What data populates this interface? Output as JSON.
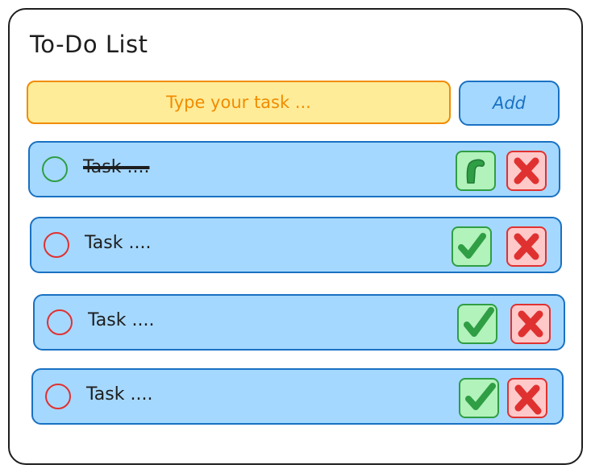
{
  "app": {
    "title": "To-Do List"
  },
  "input": {
    "placeholder": "Type your task ...",
    "value": ""
  },
  "add_button": {
    "label": "Add"
  },
  "tasks": [
    {
      "text": "Task ....",
      "done": true,
      "complete_icon": "check-icon",
      "delete_icon": "x-icon"
    },
    {
      "text": "Task ....",
      "done": false,
      "complete_icon": "check-icon",
      "delete_icon": "x-icon"
    },
    {
      "text": "Task ....",
      "done": false,
      "complete_icon": "check-icon",
      "delete_icon": "x-icon"
    },
    {
      "text": "Task ....",
      "done": false,
      "complete_icon": "check-icon",
      "delete_icon": "x-icon"
    }
  ],
  "colors": {
    "row_fill": "#a5d8ff",
    "row_border": "#1971c2",
    "input_fill": "#ffec99",
    "input_border": "#f08c00",
    "done_circle": "#2f9e44",
    "open_circle": "#e03131",
    "check_fill": "#b2f2bb",
    "check_mark": "#2f9e44",
    "delete_fill": "#ffc9c9",
    "delete_mark": "#e03131"
  }
}
